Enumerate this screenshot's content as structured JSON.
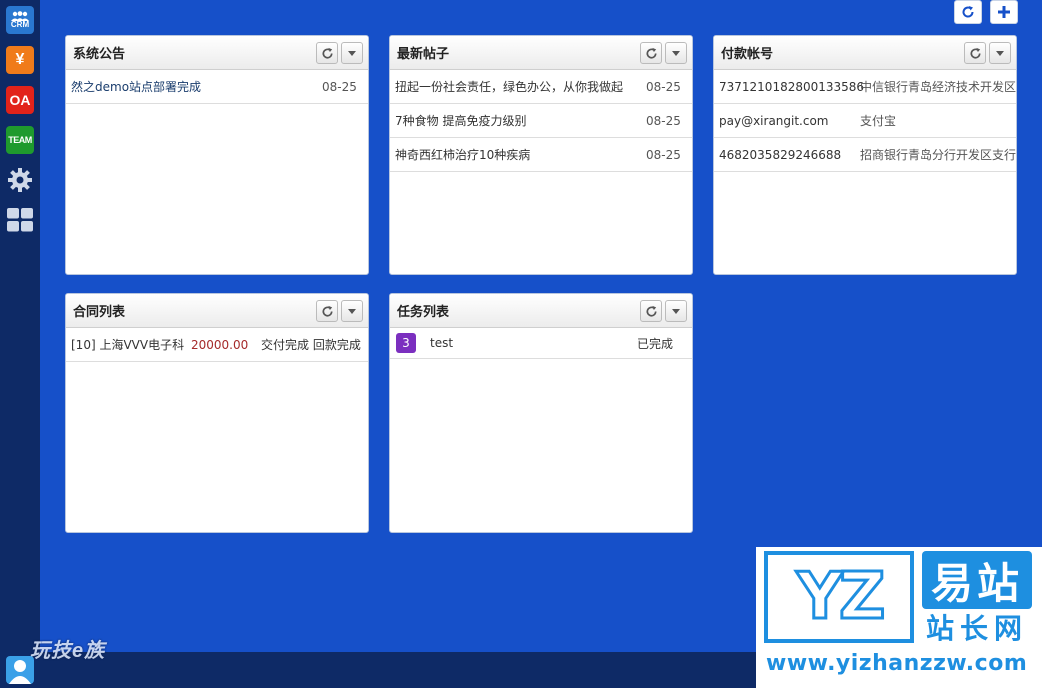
{
  "sidebar": {
    "crm_label": "CRM",
    "money_label": "¥",
    "oa_label": "OA",
    "team_label": "TEAM",
    "logo_text": "玩技e族"
  },
  "panels": {
    "announcements": {
      "title": "系统公告",
      "rows": [
        {
          "text": "然之demo站点部署完成",
          "date": "08-25"
        }
      ]
    },
    "latest_posts": {
      "title": "最新帖子",
      "rows": [
        {
          "text": "扭起一份社会责任，绿色办公，从你我做起",
          "date": "08-25"
        },
        {
          "text": "7种食物 提高免疫力级别",
          "date": "08-25"
        },
        {
          "text": "神奇西红柿治疗10种疾病",
          "date": "08-25"
        }
      ]
    },
    "payment_accounts": {
      "title": "付款帐号",
      "rows": [
        {
          "account": "7371210182800133586",
          "bank": "中信银行青岛经济技术开发区"
        },
        {
          "account": "pay@xirangit.com",
          "bank": "支付宝"
        },
        {
          "account": "4682035829246688",
          "bank": "招商银行青岛分行开发区支行"
        }
      ]
    },
    "contracts": {
      "title": "合同列表",
      "rows": [
        {
          "name": "[10] 上海VVV电子科",
          "amount": "20000.00",
          "status": "交付完成 回款完成"
        }
      ]
    },
    "tasks": {
      "title": "任务列表",
      "rows": [
        {
          "priority": "3",
          "name": "test",
          "status": "已完成"
        }
      ]
    }
  },
  "watermark": {
    "logo_letters": "YZ",
    "cn_top": "易站",
    "cn_bottom": "站长网",
    "url": "www.yizhanzzw.com"
  },
  "colors": {
    "background": "#1650c9",
    "sidebar": "#0e2a66",
    "money": "#a52a2a",
    "task_badge": "#7b2fbf",
    "watermark_blue": "#1e8fe0"
  }
}
